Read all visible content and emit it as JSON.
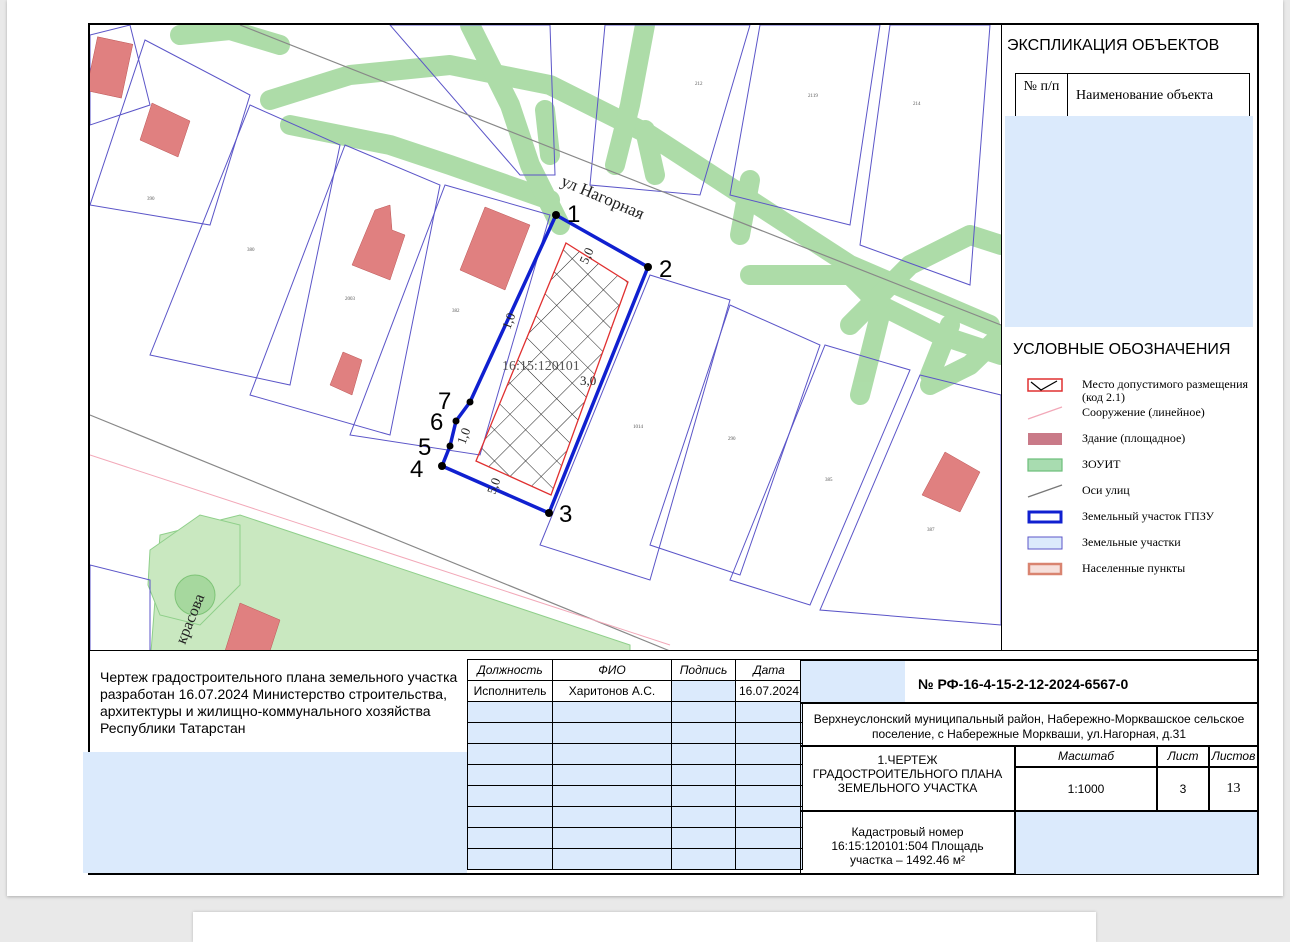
{
  "map": {
    "street_label": "ул Нагорная",
    "street2_label": "красова",
    "parcel_label": "16:15:120101",
    "points": [
      "1",
      "2",
      "3",
      "4",
      "5",
      "6",
      "7"
    ],
    "dims": [
      "5,0",
      "5,0",
      "5,0",
      "3,0",
      "1,0",
      "1,0",
      "1,0",
      "3,0"
    ],
    "small_labels": [
      "212",
      "2119",
      "214",
      "390",
      "380",
      "2003",
      "382",
      "1014",
      "290",
      "385",
      "387"
    ]
  },
  "explication": {
    "title": "ЭКСПЛИКАЦИЯ ОБЪЕКТОВ",
    "col_num": "№ п/п",
    "col_name": "Наименование объекта"
  },
  "legend": {
    "title": "УСЛОВНЫЕ ОБОЗНАЧЕНИЯ",
    "items": [
      {
        "label": "Место допустимого размещения (код 2.1)",
        "icon": "hatched-placement-icon"
      },
      {
        "label": "Сооружение (линейное)",
        "icon": "linear-structure-icon"
      },
      {
        "label": "Здание (площадное)",
        "icon": "building-icon"
      },
      {
        "label": "ЗОУИТ",
        "icon": "zone-icon"
      },
      {
        "label": "Оси улиц",
        "icon": "street-axis-icon"
      },
      {
        "label": "Земельный участок ГПЗУ",
        "icon": "gpzu-parcel-icon"
      },
      {
        "label": "Земельные участки",
        "icon": "land-parcels-icon"
      },
      {
        "label": "Населенные пункты",
        "icon": "settlements-icon"
      }
    ],
    "colors": {
      "placement": "#e03030",
      "building": "#c97a88",
      "zone": "#a8dcb0",
      "gpzu": "#1020d0",
      "parcels": "#dbeafc",
      "settlement": "#d98470"
    }
  },
  "stamp": {
    "left_text": "Чертеж градостроительного плана земельного участка разработан 16.07.2024 Министерство строительства, архитектуры и жилищно-коммунального хозяйства Республики Татарстан",
    "headers": {
      "position": "Должность",
      "name": "ФИО",
      "signature": "Подпись",
      "date": "Дата"
    },
    "row": {
      "position": "Исполнитель",
      "name": "Харитонов А.С.",
      "signature": "",
      "date": "16.07.2024"
    },
    "doc_number": "№ РФ-16-4-15-2-12-2024-6567-0",
    "address": "Верхнеуслонский муниципальный район, Набережно-Морквашское сельское поселение, с Набережные Моркваши, ул.Нагорная, д.31",
    "drawing_title": "1.ЧЕРТЕЖ ГРАДОСТРОИТЕЛЬНОГО ПЛАНА ЗЕМЕЛЬНОГО УЧАСТКА",
    "scale_label": "Масштаб",
    "sheet_label": "Лист",
    "sheets_label": "Листов",
    "scale": "1:1000",
    "sheet": "3",
    "sheets": "13",
    "cadastral": "Кадастровый номер 16:15:120101:504 Площадь участка – 1492.46 м²"
  }
}
